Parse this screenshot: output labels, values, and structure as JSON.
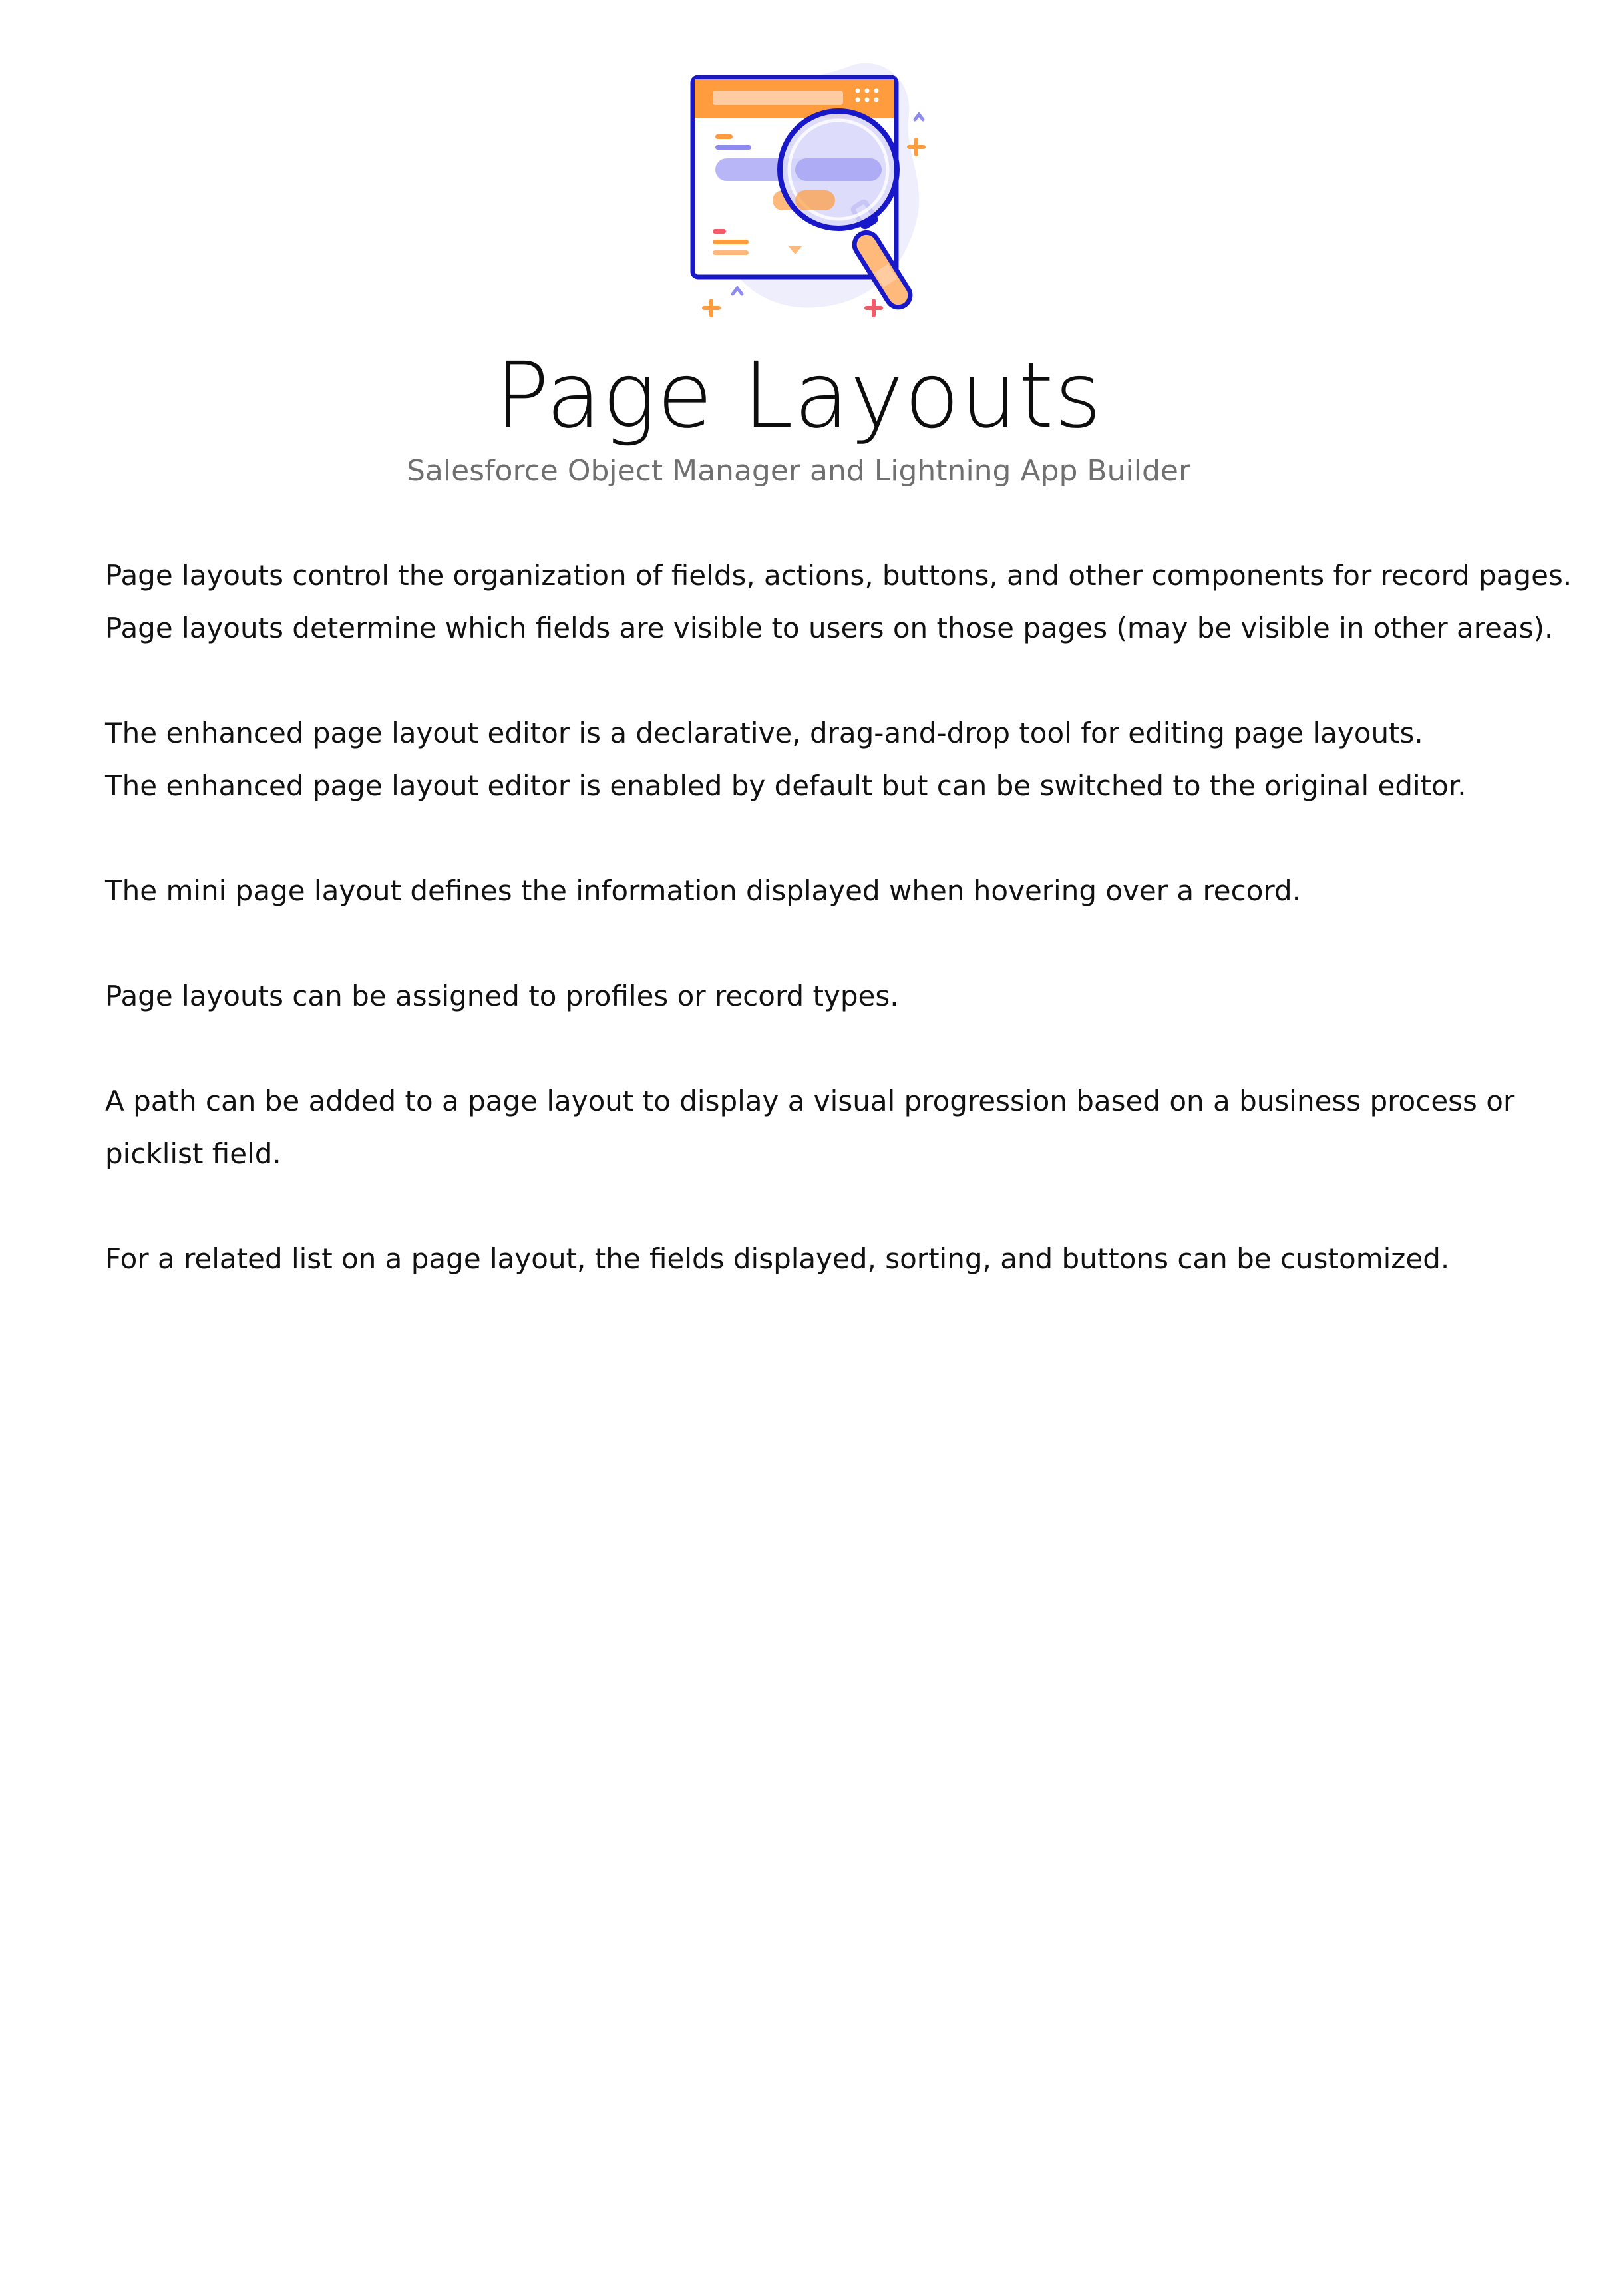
{
  "header": {
    "title": "Page Layouts",
    "subtitle": "Salesforce Object Manager and Lightning App Builder"
  },
  "hero_illustration": {
    "icon": "browser-magnifying-glass-illustration",
    "colors": {
      "orange": "#FF9C3E",
      "orange_light": "#FFB97B",
      "peach": "#FFCBA1",
      "lavender": "#B8B6F7",
      "purple": "#8E8BF0",
      "navy": "#1818C8",
      "red": "#F45B6A"
    }
  },
  "body": {
    "paragraphs": [
      {
        "lines": [
          "Page layouts control the organization of fields, actions, buttons, and other components for record pages.",
          "Page layouts determine which fields are visible to users on those pages (may be visible in other areas)."
        ]
      },
      {
        "lines": [
          "The enhanced page layout editor is a declarative, drag-and-drop tool for editing page layouts.",
          "The enhanced page layout editor is enabled by default but can be switched to the original editor."
        ]
      },
      {
        "lines": [
          "The mini page layout defines the information displayed when hovering over a record."
        ]
      },
      {
        "lines": [
          "Page layouts can be assigned to profiles or record types."
        ]
      },
      {
        "lines": [
          "A path can be added to a page layout to display a visual progression based on a business process or",
          "picklist field."
        ]
      },
      {
        "lines": [
          "For a related list on a page layout, the fields displayed, sorting, and buttons can be customized."
        ]
      }
    ]
  }
}
